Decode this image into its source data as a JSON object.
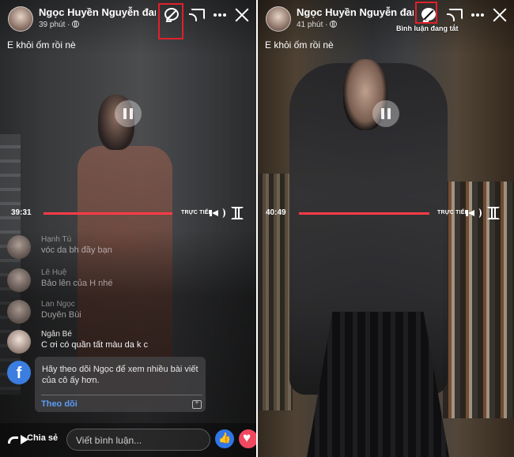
{
  "left": {
    "header": {
      "name": "Ngọc Huyền Nguyễn đang...",
      "time": "39 phút ·"
    },
    "caption": "E khỏi ốm rồi nè",
    "timeline": {
      "elapsed": "39:31",
      "live_label": "TRỰC TIẾP"
    },
    "comments": [
      {
        "name": "Hạnh Tú",
        "text": "vóc da bh đầy  bạn"
      },
      {
        "name": "Lê Huệ",
        "text": "Bảo lên của H nhé"
      },
      {
        "name": "Lan Ngọc",
        "text": "Duyên Bùi"
      },
      {
        "name": "Ngân Bé",
        "text": "C ơi có quần tất màu da k c"
      }
    ],
    "follow_card": {
      "text": "Hãy theo dõi Ngọc để xem nhiều bài viết của cô ấy hơn.",
      "button": "Theo dõi",
      "logo": "f"
    },
    "bottom": {
      "share": "Chia sẻ",
      "comment_placeholder": "Viết bình luận..."
    }
  },
  "right": {
    "header": {
      "name": "Ngọc Huyền Nguyễn đang...",
      "time": "41 phút ·",
      "comments_off_label": "Bình luận đang tắt"
    },
    "caption": "E khỏi ốm rồi nè",
    "timeline": {
      "elapsed": "40:49",
      "live_label": "TRỰC TIẾP"
    }
  },
  "colors": {
    "highlight_box": "#e0202b",
    "progress": "#ff3b47",
    "like": "#2f76e8",
    "love": "#f0485f",
    "follow": "#5b9cf5"
  }
}
